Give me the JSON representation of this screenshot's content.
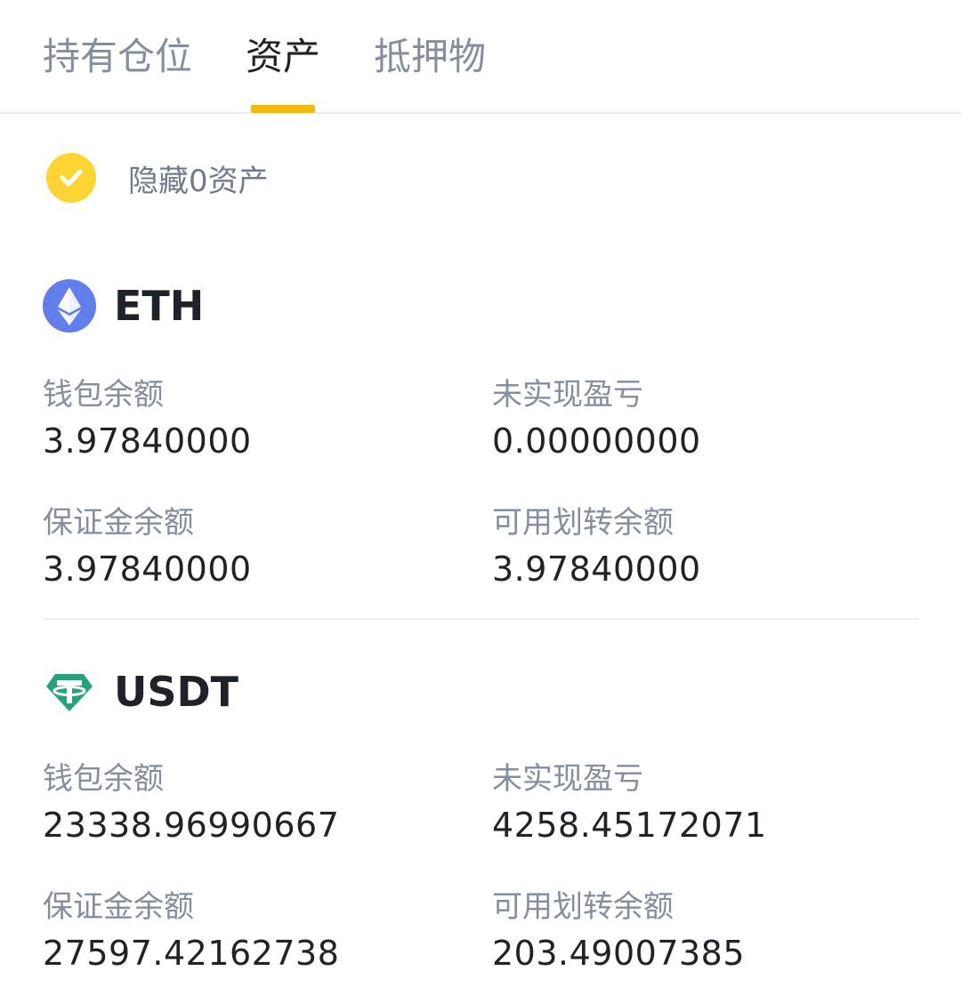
{
  "tabs": [
    {
      "label": "持有仓位"
    },
    {
      "label": "资产"
    },
    {
      "label": "抵押物"
    }
  ],
  "hide_zero": {
    "label": "隐藏0资产",
    "checked": true
  },
  "assets": [
    {
      "symbol": "ETH",
      "icon": "eth-icon",
      "wallet_balance_label": "钱包余额",
      "wallet_balance": "3.97840000",
      "unrealized_pnl_label": "未实现盈亏",
      "unrealized_pnl": "0.00000000",
      "margin_balance_label": "保证金余额",
      "margin_balance": "3.97840000",
      "transferable_label": "可用划转余额",
      "transferable": "3.97840000"
    },
    {
      "symbol": "USDT",
      "icon": "usdt-icon",
      "wallet_balance_label": "钱包余额",
      "wallet_balance": "23338.96990667",
      "unrealized_pnl_label": "未实现盈亏",
      "unrealized_pnl": "4258.45172071",
      "margin_balance_label": "保证金余额",
      "margin_balance": "27597.42162738",
      "transferable_label": "可用划转余额",
      "transferable": "203.49007385"
    }
  ],
  "colors": {
    "accent": "#f0b90b",
    "check": "#fcd535",
    "eth": "#627eea",
    "usdt": "#26a17b",
    "text_primary": "#1e2329",
    "text_secondary": "#848e9c"
  }
}
